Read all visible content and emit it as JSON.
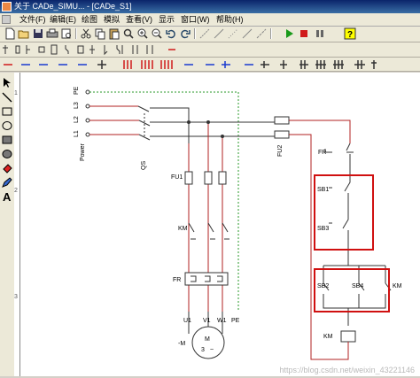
{
  "window": {
    "title": "关于 CADe_SIMU... - [CADe_S1]"
  },
  "menu": [
    "文件(F)",
    "编辑(E)",
    "绘图",
    "模拟",
    "查看(V)",
    "显示",
    "窗口(W)",
    "帮助(H)"
  ],
  "toolbar1": {
    "icons": [
      "new-file-icon",
      "open-folder-icon",
      "save-icon",
      "print-icon",
      "print-preview-icon",
      "cut-icon",
      "copy-icon",
      "paste-icon",
      "find-icon",
      "zoom-in-icon",
      "zoom-out-icon",
      "undo-icon",
      "redo-icon",
      "wire-icon",
      "wire-icon",
      "wire-icon",
      "wire-icon",
      "wire-icon",
      "play-icon",
      "stop-icon",
      "pause-icon",
      "help-icon"
    ]
  },
  "ruler": {
    "marks": [
      "1",
      "2",
      "3"
    ]
  },
  "diagram": {
    "labels": {
      "pe": "PE",
      "l3": "L3",
      "l2": "L2",
      "l1": "L1",
      "power": "Power",
      "qs": "QS",
      "fu1": "FU1",
      "fu2": "FU2",
      "km": "KM",
      "fr": "FR",
      "fr_ctrl": "FR",
      "sb1": "SB1",
      "sb3": "SB3",
      "sb2": "SB2",
      "sb4": "SB4",
      "km_coil": "KM",
      "km_contact": "KM",
      "u1": "U1",
      "v1": "V1",
      "w1": "W1",
      "pe_motor": "PE",
      "motor_m": "M",
      "motor_3": "3",
      "motor_tilde": "~",
      "motor_label": "-M"
    },
    "highlight_color": "#d01010"
  },
  "watermark": "https://blog.csdn.net/weixin_43221146"
}
